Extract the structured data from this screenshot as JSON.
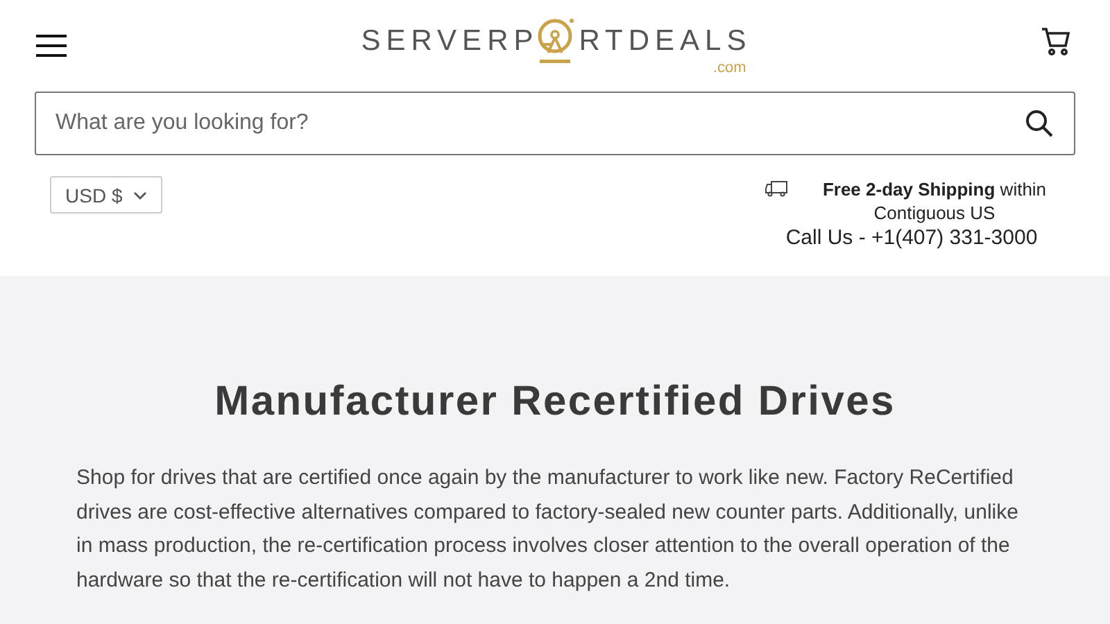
{
  "header": {
    "logo": {
      "before_icon": "SERVERP",
      "after_icon": "RTDEALS",
      "suffix": ".com"
    },
    "search": {
      "placeholder": "What are you looking for?"
    },
    "currency": {
      "value": "USD $"
    },
    "shipping": "**Free 2-day Shipping** within Contiguous US",
    "phone": "Call Us - +1(407) 331-3000"
  },
  "hero": {
    "title": "Manufacturer Recertified Drives",
    "description": "Shop for drives that are certified once again by the manufacturer to work like new. Factory ReCertified drives are cost-effective alternatives compared to factory-sealed new counter parts. Additionally, unlike in mass production, the re-certification process involves closer attention to the overall operation of the hardware so that the re-certification will not have to happen a 2nd time."
  }
}
